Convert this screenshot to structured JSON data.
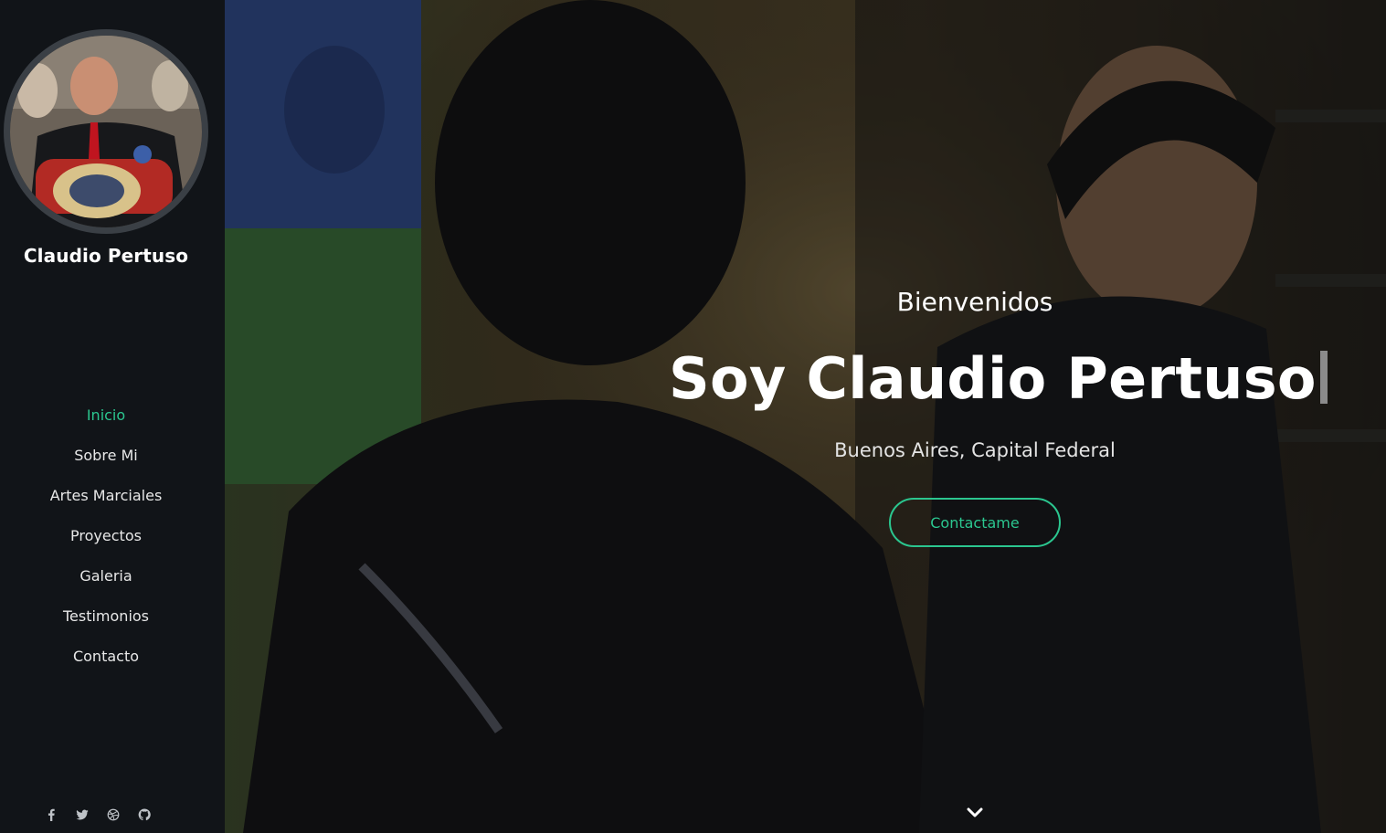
{
  "sidebar": {
    "profile_name": "Claudio Pertuso",
    "nav": [
      {
        "label": "Inicio",
        "active": true
      },
      {
        "label": "Sobre Mi",
        "active": false
      },
      {
        "label": "Artes Marciales",
        "active": false
      },
      {
        "label": "Proyectos",
        "active": false
      },
      {
        "label": "Galeria",
        "active": false
      },
      {
        "label": "Testimonios",
        "active": false
      },
      {
        "label": "Contacto",
        "active": false
      }
    ],
    "social_icons": [
      "facebook-icon",
      "twitter-icon",
      "dribbble-icon",
      "github-icon"
    ]
  },
  "hero": {
    "greeting": "Bienvenidos",
    "title": "Soy Claudio Pertuso",
    "location": "Buenos Aires, Capital Federal",
    "button_label": "Contactame",
    "scroll_icon": "chevron-down-icon"
  },
  "colors": {
    "accent": "#2bc68f",
    "sidebar_bg": "#111418",
    "text": "#ffffff"
  }
}
